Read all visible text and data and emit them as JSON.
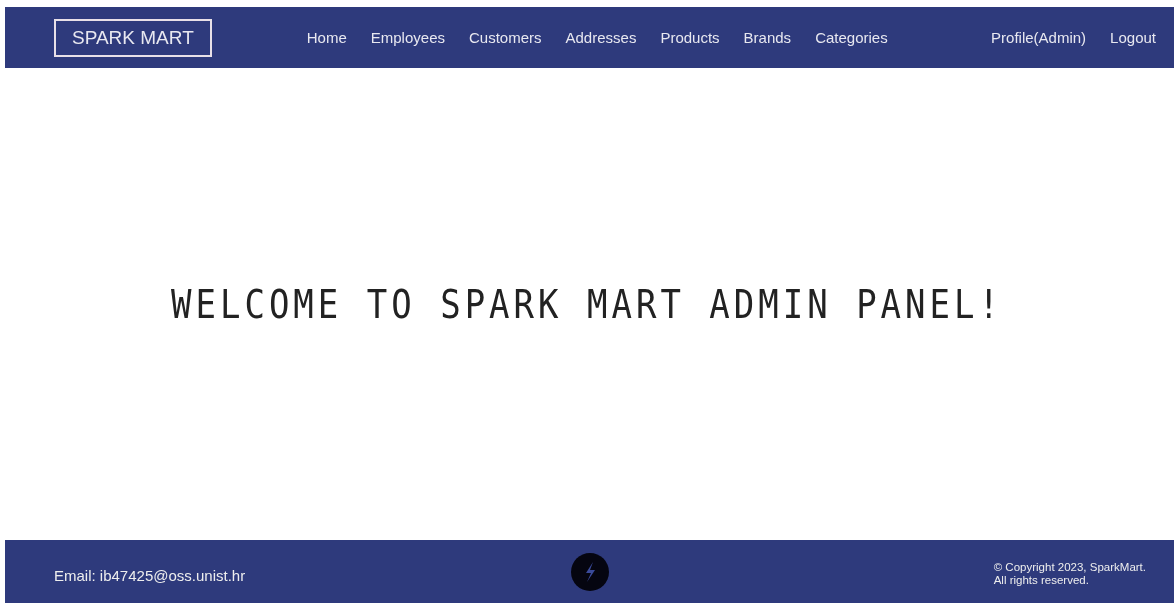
{
  "header": {
    "logo": "SPARK MART",
    "nav": [
      {
        "label": "Home"
      },
      {
        "label": "Employees"
      },
      {
        "label": "Customers"
      },
      {
        "label": "Addresses"
      },
      {
        "label": "Products"
      },
      {
        "label": "Brands"
      },
      {
        "label": "Categories"
      }
    ],
    "account": [
      {
        "label": "Profile(Admin)"
      },
      {
        "label": "Logout"
      }
    ]
  },
  "main": {
    "heading": "WELCOME TO SPARK MART ADMIN PANEL!"
  },
  "footer": {
    "email": "Email: ib47425@oss.unist.hr",
    "copyright": [
      "© Copyright 2023, SparkMart.",
      "All rights reserved."
    ]
  }
}
